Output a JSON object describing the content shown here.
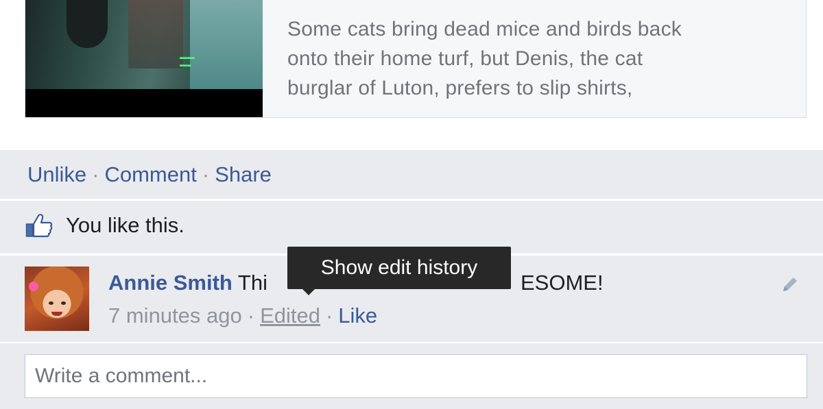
{
  "preview": {
    "lines": [
      "Some cats bring dead mice and birds back",
      "onto their home turf, but Denis, the cat",
      "burglar of Luton, prefers to slip shirts,"
    ],
    "thumbnail_icon": "video-thumbnail-icon"
  },
  "actions": {
    "unlike": "Unlike",
    "comment": "Comment",
    "share": "Share",
    "separator": "·"
  },
  "likes": {
    "icon": "thumbs-up-icon",
    "text": "You like this."
  },
  "comment": {
    "author": "Annie Smith",
    "text_visible_start": "Thi",
    "text_visible_end": "ESOME!",
    "time": "7 minutes ago",
    "edited": "Edited",
    "like": "Like",
    "separator": "·",
    "edit_icon": "pencil-icon"
  },
  "tooltip": {
    "text": "Show edit history"
  },
  "composer": {
    "placeholder": "Write a comment..."
  },
  "colors": {
    "link": "#3b5998",
    "muted": "#90949c",
    "panel": "#e9ebee",
    "tooltip_bg": "#282828"
  }
}
